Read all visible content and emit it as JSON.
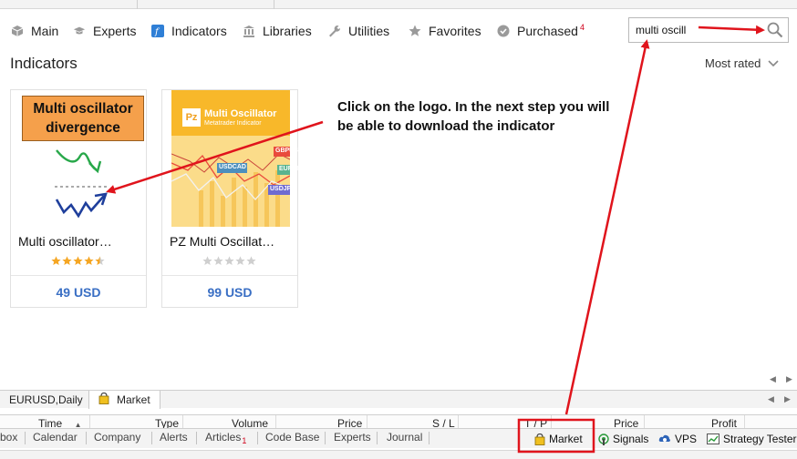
{
  "nav": {
    "main": "Main",
    "experts": "Experts",
    "indicators": "Indicators",
    "libraries": "Libraries",
    "utilities": "Utilities",
    "favorites": "Favorites",
    "purchased": "Purchased",
    "purchased_count": "4"
  },
  "search": {
    "value": "multi oscill"
  },
  "page": {
    "heading": "Indicators",
    "sort_label": "Most rated"
  },
  "products": [
    {
      "name": "Multi oscillator…",
      "price": "49 USD",
      "rating": 4.5,
      "thumb_line1": "Multi oscillator",
      "thumb_line2": "divergence"
    },
    {
      "name": "PZ Multi Oscillat…",
      "price": "99 USD",
      "rating": 0,
      "thumb_logo": "Pz",
      "thumb_title": "Multi Oscillator",
      "thumb_subtitle": "Metatrader Indicator",
      "pairs": [
        "GBPUSD",
        "USDCAD",
        "EURCHF",
        "USDJPY"
      ]
    }
  ],
  "annotation": {
    "text": "Click on the logo. In the next step you will be able to download the indicator",
    "arrow_color": "#e0141c"
  },
  "chart_tabs": {
    "tab1": "EURUSD,Daily",
    "tab2": "Market"
  },
  "columns": {
    "time": "Time",
    "type": "Type",
    "volume": "Volume",
    "price": "Price",
    "sl": "S / L",
    "tp": "T / P",
    "price2": "Price",
    "profit": "Profit"
  },
  "bottom_tabs": {
    "box": "box",
    "calendar": "Calendar",
    "company": "Company",
    "alerts": "Alerts",
    "articles": "Articles",
    "articles_count": "1",
    "codebase": "Code Base",
    "experts": "Experts",
    "journal": "Journal",
    "market": "Market",
    "signals": "Signals",
    "vps": "VPS",
    "tester": "Strategy Tester"
  }
}
